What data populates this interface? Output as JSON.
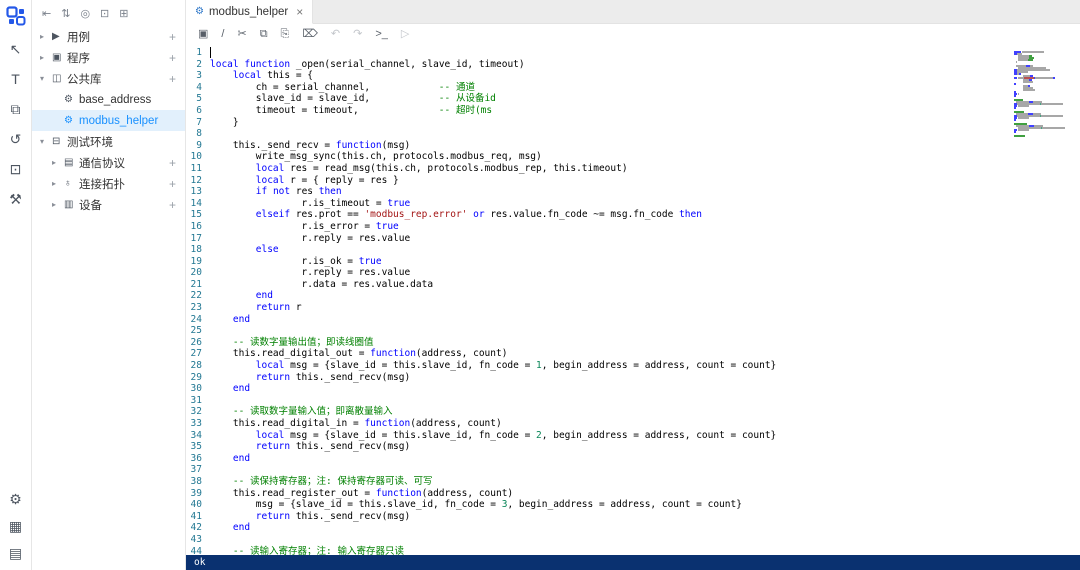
{
  "app": {
    "title": "modbus_helper"
  },
  "colors": {
    "accent": "#1890ff",
    "selected_row_bg": "#e2f0fc",
    "status_bar_bg": "#0a3170",
    "logo_blue": "#2458e8",
    "keyword": "#0000ff",
    "comment": "#008000",
    "string": "#a31515",
    "number": "#098658",
    "line_number": "#237893"
  },
  "rail": {
    "items": [
      {
        "name": "pointer-tool-icon",
        "glyph": "↖"
      },
      {
        "name": "text-tool-icon",
        "glyph": "T"
      },
      {
        "name": "windows-icon",
        "glyph": "⧉"
      },
      {
        "name": "history-icon",
        "glyph": "↺"
      },
      {
        "name": "monitor-edit-icon",
        "glyph": "⊡"
      },
      {
        "name": "tools-icon",
        "glyph": "⚒"
      }
    ],
    "bottom_items": [
      {
        "name": "settings-gear-icon",
        "glyph": "⚙"
      },
      {
        "name": "apps-grid-icon",
        "glyph": "▦"
      },
      {
        "name": "manual-book-icon",
        "glyph": "▤"
      }
    ]
  },
  "tree": {
    "chevron_down": "▾",
    "chevron_right": "▸",
    "add_glyph": "+",
    "toolbar_icons": [
      {
        "name": "collapse-all-icon",
        "glyph": "⇤"
      },
      {
        "name": "sort-icon",
        "glyph": "⇅"
      },
      {
        "name": "locate-icon",
        "glyph": "◎"
      },
      {
        "name": "folder-icon",
        "glyph": "⊡"
      },
      {
        "name": "add-new-icon",
        "glyph": "⊞"
      }
    ],
    "items": [
      {
        "name": "cases",
        "label": "用例",
        "indent": 0,
        "chevron": "▸",
        "icon_name": "cases-icon",
        "icon_glyph": "▶",
        "plus": true,
        "selected": false
      },
      {
        "name": "programs",
        "label": "程序",
        "indent": 0,
        "chevron": "▸",
        "icon_name": "program-icon",
        "icon_glyph": "▣",
        "plus": true,
        "selected": false
      },
      {
        "name": "common-library",
        "label": "公共库",
        "indent": 0,
        "chevron": "▾",
        "icon_name": "library-icon",
        "icon_glyph": "◫",
        "plus": true,
        "selected": false
      },
      {
        "name": "base-address",
        "label": "base_address",
        "indent": 1,
        "chevron": "",
        "icon_name": "module-icon",
        "icon_glyph": "⚙",
        "plus": false,
        "selected": false
      },
      {
        "name": "modbus-helper",
        "label": "modbus_helper",
        "indent": 1,
        "chevron": "",
        "icon_name": "module-icon",
        "icon_glyph": "⚙",
        "plus": false,
        "selected": true
      },
      {
        "name": "test-environment",
        "label": "测试环境",
        "indent": 0,
        "chevron": "▾",
        "icon_name": "environment-icon",
        "icon_glyph": "⊟",
        "plus": false,
        "selected": false
      },
      {
        "name": "comm-protocols",
        "label": "通信协议",
        "indent": 1,
        "chevron": "▸",
        "icon_name": "protocol-icon",
        "icon_glyph": "▤",
        "plus": true,
        "selected": false
      },
      {
        "name": "connection-topology",
        "label": "连接拓扑",
        "indent": 1,
        "chevron": "▸",
        "icon_name": "topology-icon",
        "icon_glyph": "♁",
        "plus": true,
        "selected": false
      },
      {
        "name": "devices",
        "label": "设备",
        "indent": 1,
        "chevron": "▸",
        "icon_name": "device-icon",
        "icon_glyph": "▥",
        "plus": true,
        "selected": false
      }
    ]
  },
  "editor": {
    "tab": {
      "label": "modbus_helper",
      "icon_glyph": "⚙",
      "close_glyph": "×"
    },
    "toolbar_icons": [
      {
        "name": "save-icon",
        "glyph": "▣",
        "disabled": false
      },
      {
        "name": "comment-slash-icon",
        "glyph": "/",
        "disabled": false
      },
      {
        "name": "cut-icon",
        "glyph": "✂",
        "disabled": false
      },
      {
        "name": "copy-icon",
        "glyph": "⧉",
        "disabled": false
      },
      {
        "name": "paste-icon",
        "glyph": "⎘",
        "disabled": false
      },
      {
        "name": "delete-icon",
        "glyph": "⌦",
        "disabled": false
      },
      {
        "name": "undo-icon",
        "glyph": "↶",
        "disabled": true
      },
      {
        "name": "redo-icon",
        "glyph": "↷",
        "disabled": true
      },
      {
        "name": "terminal-icon",
        "glyph": ">_",
        "disabled": false
      },
      {
        "name": "run-icon",
        "glyph": "▷",
        "disabled": true
      }
    ],
    "status": {
      "text": "ok"
    },
    "lines": [
      [],
      [
        [
          "kw",
          "local"
        ],
        [
          "txt",
          " "
        ],
        [
          "kw",
          "function"
        ],
        [
          "txt",
          " _open(serial_channel, slave_id, timeout)"
        ]
      ],
      [
        [
          "txt",
          "    "
        ],
        [
          "kw",
          "local"
        ],
        [
          "txt",
          " this = {"
        ]
      ],
      [
        [
          "txt",
          "        ch = serial_channel,            "
        ],
        [
          "cm",
          "-- 通道"
        ]
      ],
      [
        [
          "txt",
          "        slave_id = slave_id,            "
        ],
        [
          "cm",
          "-- 从设备id"
        ]
      ],
      [
        [
          "txt",
          "        timeout = timeout,              "
        ],
        [
          "cm",
          "-- 超时(ms"
        ]
      ],
      [
        [
          "txt",
          "    }"
        ]
      ],
      [],
      [
        [
          "txt",
          "    this._send_recv = "
        ],
        [
          "kw",
          "function"
        ],
        [
          "txt",
          "(msg)"
        ]
      ],
      [
        [
          "txt",
          "        write_msg_sync(this.ch, protocols.modbus_req, msg)"
        ]
      ],
      [
        [
          "txt",
          "        "
        ],
        [
          "kw",
          "local"
        ],
        [
          "txt",
          " res = read_msg(this.ch, protocols.modbus_rep, this.timeout)"
        ]
      ],
      [
        [
          "txt",
          "        "
        ],
        [
          "kw",
          "local"
        ],
        [
          "txt",
          " r = { reply = res }"
        ]
      ],
      [
        [
          "txt",
          "        "
        ],
        [
          "kw",
          "if"
        ],
        [
          "txt",
          " "
        ],
        [
          "kw",
          "not"
        ],
        [
          "txt",
          " res "
        ],
        [
          "kw",
          "then"
        ]
      ],
      [
        [
          "txt",
          "                r.is_timeout = "
        ],
        [
          "kw",
          "true"
        ]
      ],
      [
        [
          "txt",
          "        "
        ],
        [
          "kw",
          "elseif"
        ],
        [
          "txt",
          " res.prot == "
        ],
        [
          "str",
          "'modbus_rep.error'"
        ],
        [
          "txt",
          " "
        ],
        [
          "kw",
          "or"
        ],
        [
          "txt",
          " res.value.fn_code ~= msg.fn_code "
        ],
        [
          "kw",
          "then"
        ]
      ],
      [
        [
          "txt",
          "                r.is_error = "
        ],
        [
          "kw",
          "true"
        ]
      ],
      [
        [
          "txt",
          "                r.reply = res.value"
        ]
      ],
      [
        [
          "txt",
          "        "
        ],
        [
          "kw",
          "else"
        ]
      ],
      [
        [
          "txt",
          "                r.is_ok = "
        ],
        [
          "kw",
          "true"
        ]
      ],
      [
        [
          "txt",
          "                r.reply = res.value"
        ]
      ],
      [
        [
          "txt",
          "                r.data = res.value.data"
        ]
      ],
      [
        [
          "txt",
          "        "
        ],
        [
          "kw",
          "end"
        ]
      ],
      [
        [
          "txt",
          "        "
        ],
        [
          "kw",
          "return"
        ],
        [
          "txt",
          " r"
        ]
      ],
      [
        [
          "txt",
          "    "
        ],
        [
          "kw",
          "end"
        ]
      ],
      [],
      [
        [
          "txt",
          "    "
        ],
        [
          "cm",
          "-- 读数字量输出值；即读线圈值"
        ]
      ],
      [
        [
          "txt",
          "    this.read_digital_out = "
        ],
        [
          "kw",
          "function"
        ],
        [
          "txt",
          "(address, count)"
        ]
      ],
      [
        [
          "txt",
          "        "
        ],
        [
          "kw",
          "local"
        ],
        [
          "txt",
          " msg = {slave_id = this.slave_id, fn_code = "
        ],
        [
          "num",
          "1"
        ],
        [
          "txt",
          ", begin_address = address, count = count}"
        ]
      ],
      [
        [
          "txt",
          "        "
        ],
        [
          "kw",
          "return"
        ],
        [
          "txt",
          " this._send_recv(msg)"
        ]
      ],
      [
        [
          "txt",
          "    "
        ],
        [
          "kw",
          "end"
        ]
      ],
      [],
      [
        [
          "txt",
          "    "
        ],
        [
          "cm",
          "-- 读取数字量输入值；即离散量输入"
        ]
      ],
      [
        [
          "txt",
          "    this.read_digital_in = "
        ],
        [
          "kw",
          "function"
        ],
        [
          "txt",
          "(address, count)"
        ]
      ],
      [
        [
          "txt",
          "        "
        ],
        [
          "kw",
          "local"
        ],
        [
          "txt",
          " msg = {slave_id = this.slave_id, fn_code = "
        ],
        [
          "num",
          "2"
        ],
        [
          "txt",
          ", begin_address = address, count = count}"
        ]
      ],
      [
        [
          "txt",
          "        "
        ],
        [
          "kw",
          "return"
        ],
        [
          "txt",
          " this._send_recv(msg)"
        ]
      ],
      [
        [
          "txt",
          "    "
        ],
        [
          "kw",
          "end"
        ]
      ],
      [],
      [
        [
          "txt",
          "    "
        ],
        [
          "cm",
          "-- 读保持寄存器；注: 保持寄存器可读、可写"
        ]
      ],
      [
        [
          "txt",
          "    this.read_register_out = "
        ],
        [
          "kw",
          "function"
        ],
        [
          "txt",
          "(address, count)"
        ]
      ],
      [
        [
          "txt",
          "        msg = {slave_id = this.slave_id, fn_code = "
        ],
        [
          "num",
          "3"
        ],
        [
          "txt",
          ", begin_address = address, count = count}"
        ]
      ],
      [
        [
          "txt",
          "        "
        ],
        [
          "kw",
          "return"
        ],
        [
          "txt",
          " this._send_recv(msg)"
        ]
      ],
      [
        [
          "txt",
          "    "
        ],
        [
          "kw",
          "end"
        ]
      ],
      [],
      [
        [
          "txt",
          "    "
        ],
        [
          "cm",
          "-- 读输入寄存器；注: 输入寄存器只读"
        ]
      ]
    ]
  }
}
